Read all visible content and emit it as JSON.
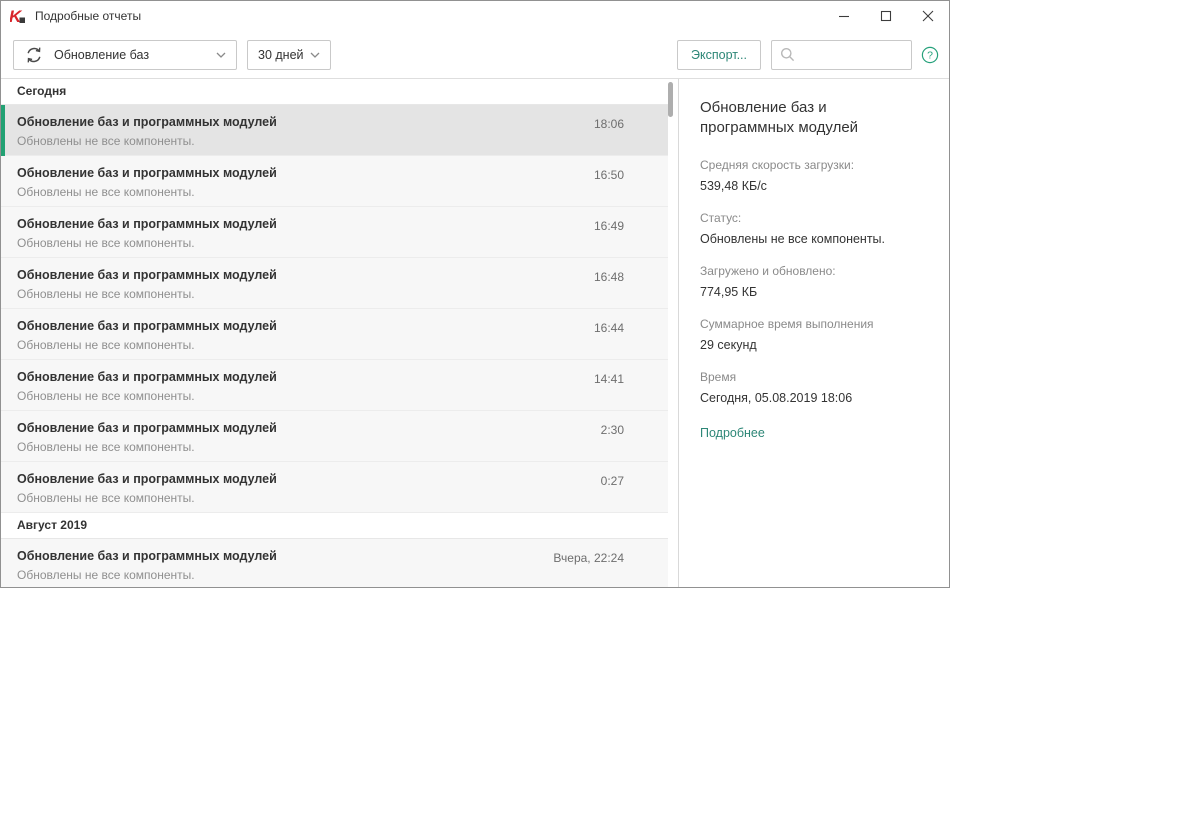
{
  "window": {
    "title": "Подробные отчеты"
  },
  "icons": {
    "app_logo": "kaspersky-logo",
    "report_type_dropdown": "refresh-icon",
    "dropdown_chevron": "chevron-down-icon",
    "search": "magnifier-icon",
    "help": "question-circle-icon",
    "window_controls": [
      "minimize-icon",
      "maximize-icon",
      "close-icon"
    ]
  },
  "toolbar": {
    "report_type_value": "Обновление баз",
    "period_value": "30 дней",
    "export_label": "Экспорт...",
    "search_placeholder": "",
    "search_value": ""
  },
  "list": {
    "sections": [
      {
        "header": "Сегодня",
        "items": [
          {
            "title": "Обновление баз и программных модулей",
            "subtitle": "Обновлены не все компоненты.",
            "time": "18:06",
            "selected": true
          },
          {
            "title": "Обновление баз и программных модулей",
            "subtitle": "Обновлены не все компоненты.",
            "time": "16:50",
            "selected": false
          },
          {
            "title": "Обновление баз и программных модулей",
            "subtitle": "Обновлены не все компоненты.",
            "time": "16:49",
            "selected": false
          },
          {
            "title": "Обновление баз и программных модулей",
            "subtitle": "Обновлены не все компоненты.",
            "time": "16:48",
            "selected": false
          },
          {
            "title": "Обновление баз и программных модулей",
            "subtitle": "Обновлены не все компоненты.",
            "time": "16:44",
            "selected": false
          },
          {
            "title": "Обновление баз и программных модулей",
            "subtitle": "Обновлены не все компоненты.",
            "time": "14:41",
            "selected": false
          },
          {
            "title": "Обновление баз и программных модулей",
            "subtitle": "Обновлены не все компоненты.",
            "time": "2:30",
            "selected": false
          },
          {
            "title": "Обновление баз и программных модулей",
            "subtitle": "Обновлены не все компоненты.",
            "time": "0:27",
            "selected": false
          }
        ]
      },
      {
        "header": "Август 2019",
        "items": [
          {
            "title": "Обновление баз и программных модулей",
            "subtitle": "Обновлены не все компоненты.",
            "time": "Вчера, 22:24",
            "selected": false
          }
        ]
      }
    ]
  },
  "details": {
    "title": "Обновление баз и программных модулей",
    "fields": [
      {
        "label": "Средняя скорость загрузки:",
        "value": "539,48 КБ/с"
      },
      {
        "label": "Статус:",
        "value": "Обновлены не все компоненты."
      },
      {
        "label": "Загружено и обновлено:",
        "value": "774,95 КБ"
      },
      {
        "label": "Суммарное время выполнения",
        "value": "29 секунд"
      },
      {
        "label": "Время",
        "value": "Сегодня, 05.08.2019 18:06"
      }
    ],
    "more_link": "Подробнее"
  },
  "colors": {
    "accent_green": "#22a173",
    "link_teal": "#2d8777",
    "brand_red": "#d8252b",
    "selected_row_bg": "#e4e4e4",
    "row_bg": "#f7f7f7",
    "window_border": "#919191"
  }
}
